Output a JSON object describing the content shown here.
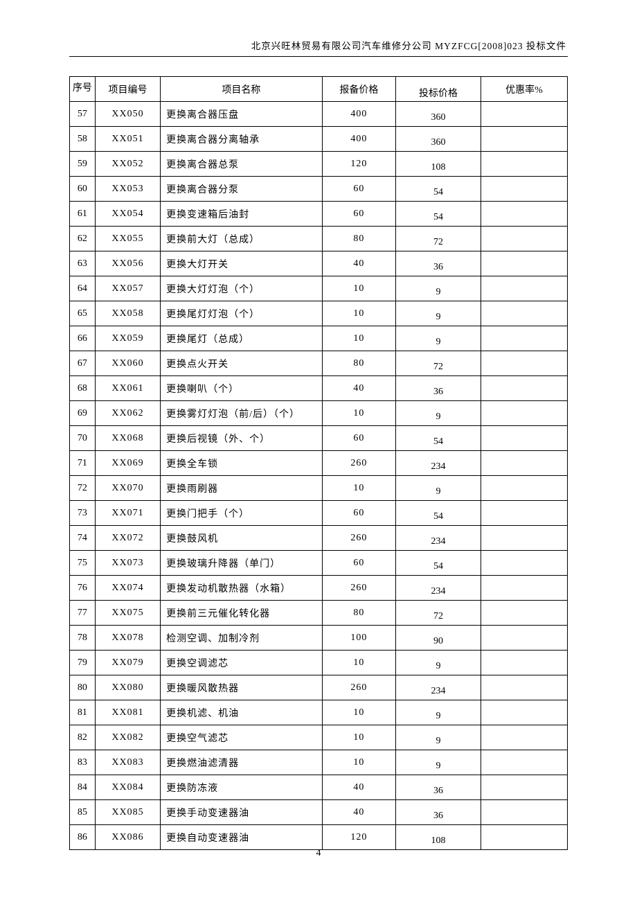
{
  "header": "北京兴旺林贸易有限公司汽车维修分公司 MYZFCG[2008]023 投标文件",
  "page_number": "4",
  "table": {
    "headers": {
      "seq": "序号",
      "code": "项目编号",
      "name": "项目名称",
      "base_price": "报备价格",
      "bid_price": "投标价格",
      "discount": "优惠率%"
    },
    "rows": [
      {
        "seq": "57",
        "code": "XX050",
        "name": "更换离合器压盘",
        "base": "400",
        "bid": "360",
        "disc": ""
      },
      {
        "seq": "58",
        "code": "XX051",
        "name": "更换离合器分离轴承",
        "base": "400",
        "bid": "360",
        "disc": ""
      },
      {
        "seq": "59",
        "code": "XX052",
        "name": "更换离合器总泵",
        "base": "120",
        "bid": "108",
        "disc": ""
      },
      {
        "seq": "60",
        "code": "XX053",
        "name": "更换离合器分泵",
        "base": "60",
        "bid": "54",
        "disc": ""
      },
      {
        "seq": "61",
        "code": "XX054",
        "name": "更换变速箱后油封",
        "base": "60",
        "bid": "54",
        "disc": ""
      },
      {
        "seq": "62",
        "code": "XX055",
        "name": "更换前大灯（总成）",
        "base": "80",
        "bid": "72",
        "disc": ""
      },
      {
        "seq": "63",
        "code": "XX056",
        "name": "更换大灯开关",
        "base": "40",
        "bid": "36",
        "disc": ""
      },
      {
        "seq": "64",
        "code": "XX057",
        "name": "更换大灯灯泡（个）",
        "base": "10",
        "bid": "9",
        "disc": ""
      },
      {
        "seq": "65",
        "code": "XX058",
        "name": "更换尾灯灯泡（个）",
        "base": "10",
        "bid": "9",
        "disc": ""
      },
      {
        "seq": "66",
        "code": "XX059",
        "name": "更换尾灯（总成）",
        "base": "10",
        "bid": "9",
        "disc": ""
      },
      {
        "seq": "67",
        "code": "XX060",
        "name": "更换点火开关",
        "base": "80",
        "bid": "72",
        "disc": ""
      },
      {
        "seq": "68",
        "code": "XX061",
        "name": "更换喇叭（个）",
        "base": "40",
        "bid": "36",
        "disc": ""
      },
      {
        "seq": "69",
        "code": "XX062",
        "name": "更换雾灯灯泡（前/后）（个）",
        "base": "10",
        "bid": "9",
        "disc": ""
      },
      {
        "seq": "70",
        "code": "XX068",
        "name": "更换后视镜（外、个）",
        "base": "60",
        "bid": "54",
        "disc": ""
      },
      {
        "seq": "71",
        "code": "XX069",
        "name": "更换全车锁",
        "base": "260",
        "bid": "234",
        "disc": ""
      },
      {
        "seq": "72",
        "code": "XX070",
        "name": "更换雨刷器",
        "base": "10",
        "bid": "9",
        "disc": ""
      },
      {
        "seq": "73",
        "code": "XX071",
        "name": "更换门把手（个）",
        "base": "60",
        "bid": "54",
        "disc": ""
      },
      {
        "seq": "74",
        "code": "XX072",
        "name": "更换鼓风机",
        "base": "260",
        "bid": "234",
        "disc": ""
      },
      {
        "seq": "75",
        "code": "XX073",
        "name": "更换玻璃升降器（单门）",
        "base": "60",
        "bid": "54",
        "disc": ""
      },
      {
        "seq": "76",
        "code": "XX074",
        "name": "更换发动机散热器（水箱）",
        "base": "260",
        "bid": "234",
        "disc": ""
      },
      {
        "seq": "77",
        "code": "XX075",
        "name": "更换前三元催化转化器",
        "base": "80",
        "bid": "72",
        "disc": ""
      },
      {
        "seq": "78",
        "code": "XX078",
        "name": "检测空调、加制冷剂",
        "base": "100",
        "bid": "90",
        "disc": ""
      },
      {
        "seq": "79",
        "code": "XX079",
        "name": "更换空调滤芯",
        "base": "10",
        "bid": "9",
        "disc": ""
      },
      {
        "seq": "80",
        "code": "XX080",
        "name": "更换暖风散热器",
        "base": "260",
        "bid": "234",
        "disc": ""
      },
      {
        "seq": "81",
        "code": "XX081",
        "name": "更换机滤、机油",
        "base": "10",
        "bid": "9",
        "disc": ""
      },
      {
        "seq": "82",
        "code": "XX082",
        "name": "更换空气滤芯",
        "base": "10",
        "bid": "9",
        "disc": ""
      },
      {
        "seq": "83",
        "code": "XX083",
        "name": "更换燃油滤清器",
        "base": "10",
        "bid": "9",
        "disc": ""
      },
      {
        "seq": "84",
        "code": "XX084",
        "name": "更换防冻液",
        "base": "40",
        "bid": "36",
        "disc": ""
      },
      {
        "seq": "85",
        "code": "XX085",
        "name": "更换手动变速器油",
        "base": "40",
        "bid": "36",
        "disc": ""
      },
      {
        "seq": "86",
        "code": "XX086",
        "name": "更换自动变速器油",
        "base": "120",
        "bid": "108",
        "disc": ""
      }
    ]
  }
}
